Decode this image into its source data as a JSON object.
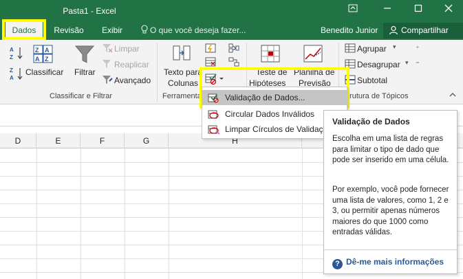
{
  "window": {
    "title": "Pasta1 - Excel",
    "restore_icon": "ribbon-display-options-icon",
    "minimize_icon": "minimize-icon",
    "maximize_icon": "maximize-icon",
    "close_icon": "close-icon"
  },
  "tabs": {
    "items": [
      "Dados",
      "Revisão",
      "Exibir"
    ],
    "active": "Dados",
    "tell_me_placeholder": "O que você deseja fazer...",
    "user_name": "Benedito Junior",
    "share_label": "Compartilhar"
  },
  "ribbon": {
    "sort_filter": {
      "sort_az_icon": "sort-az-icon",
      "sort_za_icon": "sort-za-icon",
      "sort_label": "Classificar",
      "filter_label": "Filtrar",
      "clear_label": "Limpar",
      "reapply_label": "Reaplicar",
      "advanced_label": "Avançado",
      "group_label": "Classificar e Filtrar"
    },
    "data_tools": {
      "text_to_columns_line1": "Texto para",
      "text_to_columns_line2": "Colunas",
      "group_label": "Ferramenta"
    },
    "forecast": {
      "what_if_line1": "Teste de",
      "what_if_line2": "Hipóteses",
      "forecast_sheet_line1": "Planilha de",
      "forecast_sheet_line2": "Previsão"
    },
    "outline": {
      "group_label": "Agrupar",
      "ungroup_label": "Desagrupar",
      "subtotal_label": "Subtotal",
      "section_label": "trutura de Tópicos"
    }
  },
  "grid": {
    "columns": [
      "D",
      "E",
      "F",
      "G",
      "H"
    ]
  },
  "dropdown": {
    "items": [
      {
        "label": "Validação de Dados...",
        "selected": true,
        "icon": "data-validation-icon"
      },
      {
        "label": "Circular Dados Inválidos",
        "selected": false,
        "icon": "circle-invalid-data-icon"
      },
      {
        "label": "Limpar Círculos de Validaçã",
        "selected": false,
        "icon": "clear-validation-circles-icon"
      }
    ]
  },
  "tooltip": {
    "title": "Validação de Dados",
    "paragraph1": "Escolha em uma lista de regras para limitar o tipo de dado que pode ser inserido em uma célula.",
    "paragraph2": "Por exemplo, você pode fornecer uma lista de valores, como 1, 2 e 3, ou permitir apenas números maiores do que 1000 como entradas válidas.",
    "link_label": "Dê-me mais informações"
  },
  "colors": {
    "excel_green": "#217346",
    "highlight_yellow": "#ffff00",
    "link_blue": "#2b579a"
  }
}
